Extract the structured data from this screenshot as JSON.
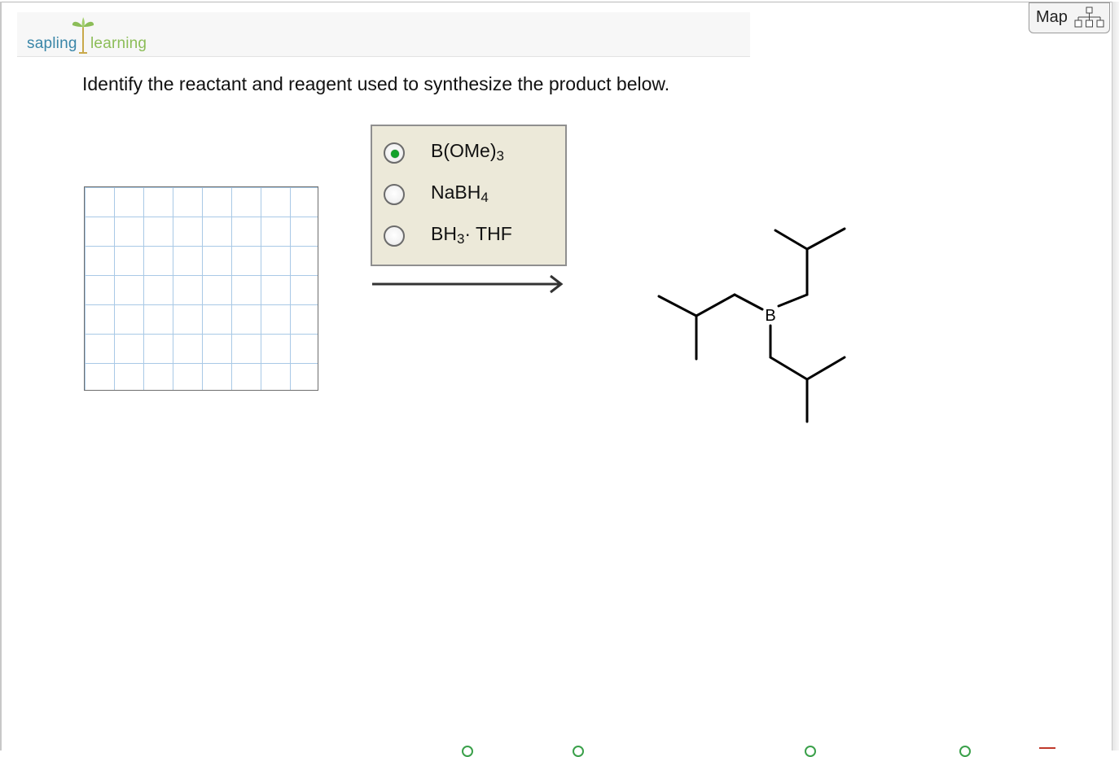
{
  "header": {
    "logo_sapling": "sapling",
    "logo_learning": "learning",
    "map_label": "Map"
  },
  "question": {
    "text": "Identify the reactant and reagent used to synthesize the product below."
  },
  "reagent_options": [
    {
      "formula": "B(OMe)",
      "subscript": "3",
      "suffix": "",
      "selected": true
    },
    {
      "formula": "NaBH",
      "subscript": "4",
      "suffix": "",
      "selected": false
    },
    {
      "formula": "BH",
      "subscript": "3",
      "suffix": "· THF",
      "selected": false
    }
  ],
  "product": {
    "atom_label": "B"
  },
  "colors": {
    "accent_green": "#12a12a",
    "brand_blue": "#3a86a8",
    "brand_green": "#8cbd58",
    "panel_bg": "#ece9d9",
    "grid_line": "#a9c9e6"
  }
}
